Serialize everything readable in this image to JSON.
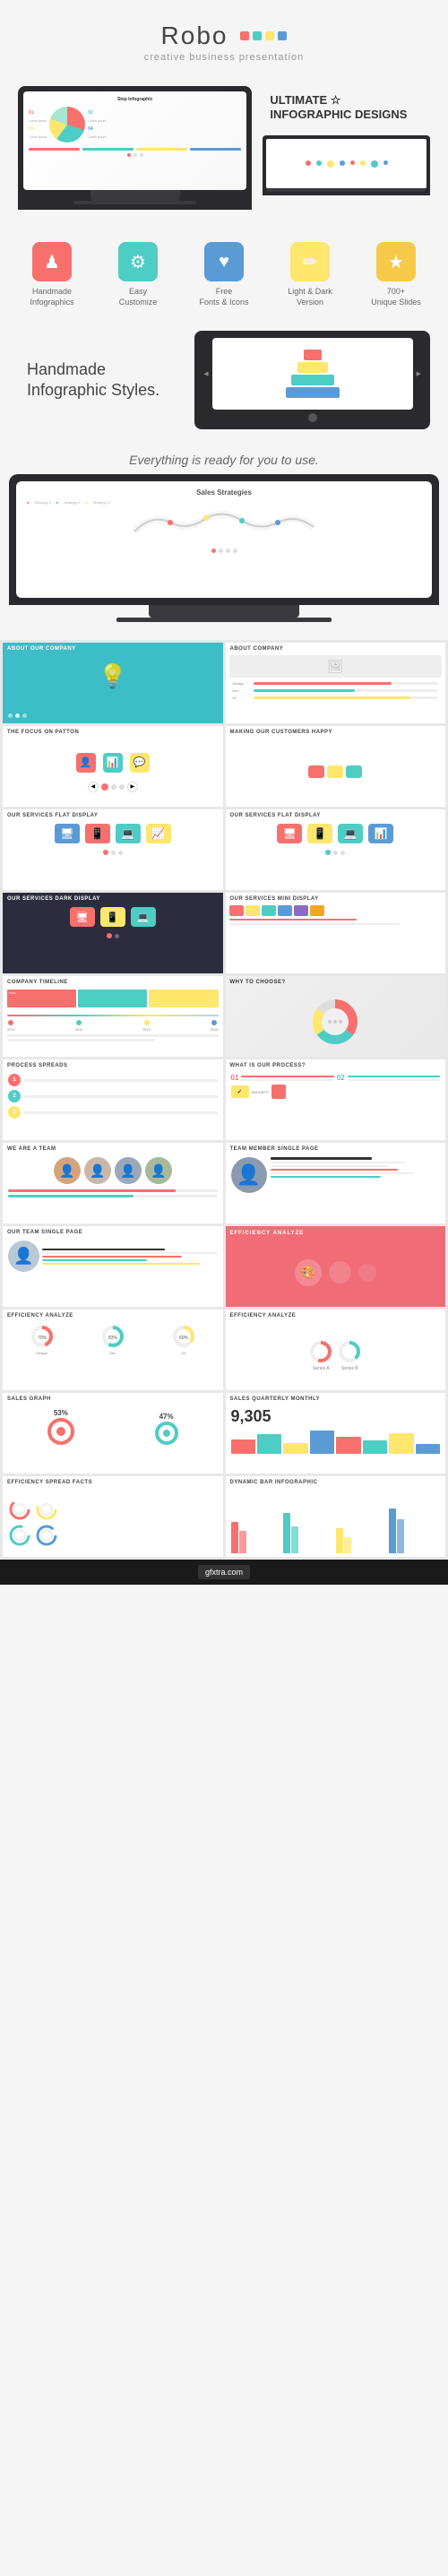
{
  "header": {
    "title": "Robo",
    "subtitle": "creative business presentation",
    "dots": [
      {
        "color": "#f7706d"
      },
      {
        "color": "#4ecdc4"
      },
      {
        "color": "#ffe66d"
      },
      {
        "color": "#5b9bd5"
      }
    ]
  },
  "hero": {
    "ultimate_line1": "ULTIMATE ☆",
    "ultimate_line2": "INFOGRAPHIC DESIGNS"
  },
  "features": [
    {
      "icon": "♟",
      "color": "#f7706d",
      "label": "Handmade\nInfographics"
    },
    {
      "icon": "⚙",
      "color": "#4ecdc4",
      "label": "Easy\nCustomize"
    },
    {
      "icon": "♥",
      "color": "#5b9bd5",
      "label": "Free\nFonts & Icons"
    },
    {
      "icon": "✏",
      "color": "#ffe66d",
      "label": "Light & Dark\nVersion"
    },
    {
      "icon": "★",
      "color": "#f7c948",
      "label": "700+\nUnique Slides"
    }
  ],
  "handmade": {
    "title": "Handmade\nInfographic Styles."
  },
  "ready": {
    "text": "Everything is ready for you to use."
  },
  "sales": {
    "title": "Sales Strategies"
  },
  "slides": {
    "about_company": "ABOUT OUR COMPANY",
    "about_company2": "About Company",
    "the_team": "The Focus on Patton",
    "making_customers": "Making Our Customers Happy",
    "services_flat": "Our Services Flat Display",
    "services_flat2": "Our Services Flat Display",
    "services_dark": "Our Services Dark Display",
    "services_mini": "Our Services Mini Display",
    "timeline": "Company Timeline",
    "why_choose": "WHY TO CHOOSE?",
    "process": "What is Our Process?",
    "process2": "Process Spreads",
    "efficiency": "Efficiency Analyze",
    "we_are_team": "We are a Team",
    "team_member": "Team Member Single Page",
    "team_single": "Our Team Single Page",
    "efficiency2": "EFFICIENCY ANALYZE",
    "efficiency3": "Efficiency Analyze",
    "efficiency4": "Efficiency Analyze",
    "sales_graph": "Sales Graph",
    "sales_quarterly": "Sales Quarterly Monthly",
    "big_number": "9,305",
    "percent1": "53%",
    "percent2": "47%",
    "efficiency_spread": "Efficiency Spread Facts",
    "dynamic_bar": "Dynamic Bar Infographic"
  },
  "colors": {
    "teal": "#3dbdc7",
    "coral": "#f7706d",
    "yellow": "#f5c842",
    "pink": "#f06d78",
    "mint": "#4ecdc4",
    "blue": "#5b9bd5",
    "dark": "#2c2c3e",
    "purple": "#8e6bbf",
    "orange": "#f5a623",
    "green": "#7ac97a"
  }
}
